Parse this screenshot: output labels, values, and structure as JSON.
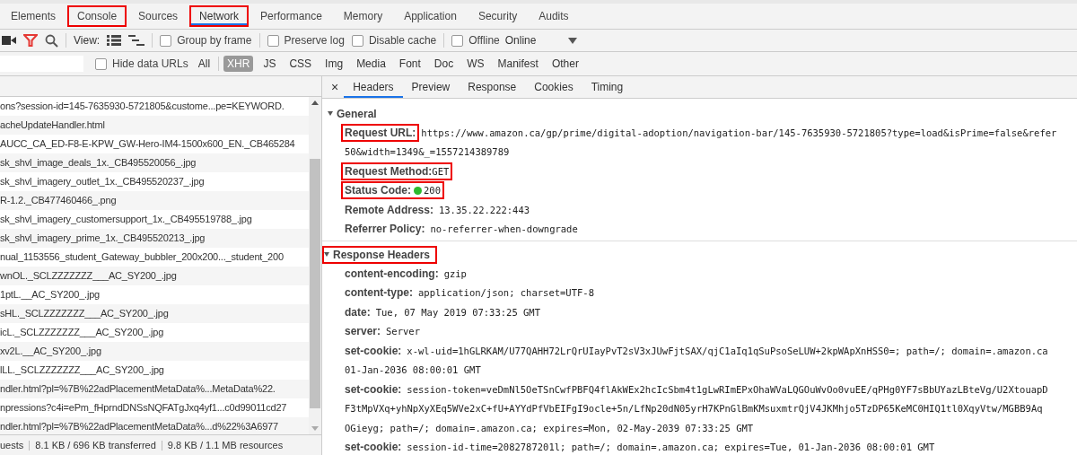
{
  "main_tabs": [
    {
      "label": "Elements",
      "selected": false,
      "highlighted": false
    },
    {
      "label": "Console",
      "selected": false,
      "highlighted": true
    },
    {
      "label": "Sources",
      "selected": false,
      "highlighted": false
    },
    {
      "label": "Network",
      "selected": true,
      "highlighted": true
    },
    {
      "label": "Performance",
      "selected": false,
      "highlighted": false
    },
    {
      "label": "Memory",
      "selected": false,
      "highlighted": false
    },
    {
      "label": "Application",
      "selected": false,
      "highlighted": false
    },
    {
      "label": "Security",
      "selected": false,
      "highlighted": false
    },
    {
      "label": "Audits",
      "selected": false,
      "highlighted": false
    }
  ],
  "toolbar": {
    "view_label": "View:",
    "options": [
      {
        "label": "Group by frame",
        "checked": false
      },
      {
        "label": "Preserve log",
        "checked": false
      },
      {
        "label": "Disable cache",
        "checked": false
      },
      {
        "label": "Offline",
        "checked": false
      }
    ],
    "throttling": "Online"
  },
  "filter_bar": {
    "hide_data_urls": {
      "label": "Hide data URLs",
      "checked": false
    },
    "types": [
      {
        "label": "All",
        "selected": false
      },
      {
        "label": "XHR",
        "selected": true
      },
      {
        "label": "JS",
        "selected": false
      },
      {
        "label": "CSS",
        "selected": false
      },
      {
        "label": "Img",
        "selected": false
      },
      {
        "label": "Media",
        "selected": false
      },
      {
        "label": "Font",
        "selected": false
      },
      {
        "label": "Doc",
        "selected": false
      },
      {
        "label": "WS",
        "selected": false
      },
      {
        "label": "Manifest",
        "selected": false
      },
      {
        "label": "Other",
        "selected": false
      }
    ]
  },
  "requests": [
    "ons?session-id=145-7635930-5721805&custome...pe=KEYWORD.",
    "acheUpdateHandler.html",
    "AUCC_CA_ED-F8-E-KPW_GW-Hero-IM4-1500x600_EN._CB465284",
    "sk_shvl_image_deals_1x._CB495520056_.jpg",
    "sk_shvl_imagery_outlet_1x._CB495520237_.jpg",
    "R-1.2._CB477460466_.png",
    "sk_shvl_imagery_customersupport_1x._CB495519788_.jpg",
    "sk_shvl_imagery_prime_1x._CB495520213_.jpg",
    "nual_1153556_student_Gateway_bubbler_200x200..._student_200",
    "wnOL._SCLZZZZZZZ___AC_SY200_.jpg",
    "1ptL.__AC_SY200_.jpg",
    "sHL._SCLZZZZZZZ___AC_SY200_.jpg",
    "icL._SCLZZZZZZZ___AC_SY200_.jpg",
    "xv2L.__AC_SY200_.jpg",
    "lLL._SCLZZZZZZZ___AC_SY200_.jpg",
    "ndler.html?pl=%7B%22adPlacementMetaData%...MetaData%22.",
    "npressions?c4i=ePm_fHprndDNSsNQFATgJxq4yf1...c0d99011cd27",
    "ndler.html?pl=%7B%22adPlacementMetaData%...d%22%3A6977"
  ],
  "status_bar": [
    "uests",
    "8.1 KB / 696 KB transferred",
    "9.8 KB / 1.1 MB resources"
  ],
  "detail_close": "×",
  "detail_tabs": [
    {
      "label": "Headers",
      "selected": true
    },
    {
      "label": "Preview",
      "selected": false
    },
    {
      "label": "Response",
      "selected": false
    },
    {
      "label": "Cookies",
      "selected": false
    },
    {
      "label": "Timing",
      "selected": false
    }
  ],
  "general": {
    "title": "General",
    "expanded": true,
    "items": [
      {
        "kind": "text",
        "name": "Request URL:",
        "value": "https://www.amazon.ca/gp/prime/digital-adoption/navigation-bar/145-7635930-5721805?type=load&isPrime=false&refer",
        "wrap": [
          "50&width=1349&_=1557214389789"
        ],
        "highlighted": true
      },
      {
        "kind": "text",
        "name": "Request Method:",
        "value": "GET",
        "highlighted": true
      },
      {
        "kind": "status",
        "name": "Status Code:",
        "value": "200",
        "highlighted": true
      },
      {
        "kind": "text",
        "name": "Remote Address:",
        "value": "13.35.22.222:443",
        "highlighted": false
      },
      {
        "kind": "text",
        "name": "Referrer Policy:",
        "value": "no-referrer-when-downgrade",
        "highlighted": false
      }
    ]
  },
  "response_headers": {
    "title": "Response Headers",
    "expanded": true,
    "highlighted": true,
    "items": [
      {
        "name": "content-encoding:",
        "value": "gzip"
      },
      {
        "name": "content-type:",
        "value": "application/json; charset=UTF-8"
      },
      {
        "name": "date:",
        "value": "Tue, 07 May 2019 07:33:25 GMT"
      },
      {
        "name": "server:",
        "value": "Server"
      },
      {
        "name": "set-cookie:",
        "value": "x-wl-uid=1hGLRKAM/U77QAHH72LrQrUIayPvT2sV3xJUwFjtSAX/qjC1aIq1qSuPsoSeLUW+2kpWApXnHSS0=; path=/; domain=.amazon.ca",
        "wrap": [
          "01-Jan-2036 08:00:01 GMT"
        ]
      },
      {
        "name": "set-cookie:",
        "value": "session-token=veDmNl5OeTSnCwfPBFQ4flAkWEx2hcIcSbm4t1gLwRImEPxOhaWVaLQGOuWvOo0vuEE/qPHg0YF7sBbUYazLBteVg/U2XtouapD",
        "wrap": [
          "F3tMpVXq+yhNpXyXEq5WVe2xC+fU+AYYdPfVbEIFgI9ocle+5n/LfNp20dN05yrH7KPnGlBmKMsuxmtrQjV4JKMhjo5TzDP65KeMC0HIQ1tl0XqyVtw/MGBB9Aq",
          "OGieyg; path=/; domain=.amazon.ca; expires=Mon, 02-May-2039 07:33:25 GMT"
        ]
      },
      {
        "name": "set-cookie:",
        "value": "session-id-time=2082787201l; path=/; domain=.amazon.ca; expires=Tue, 01-Jan-2036 08:00:01 GMT"
      }
    ]
  }
}
